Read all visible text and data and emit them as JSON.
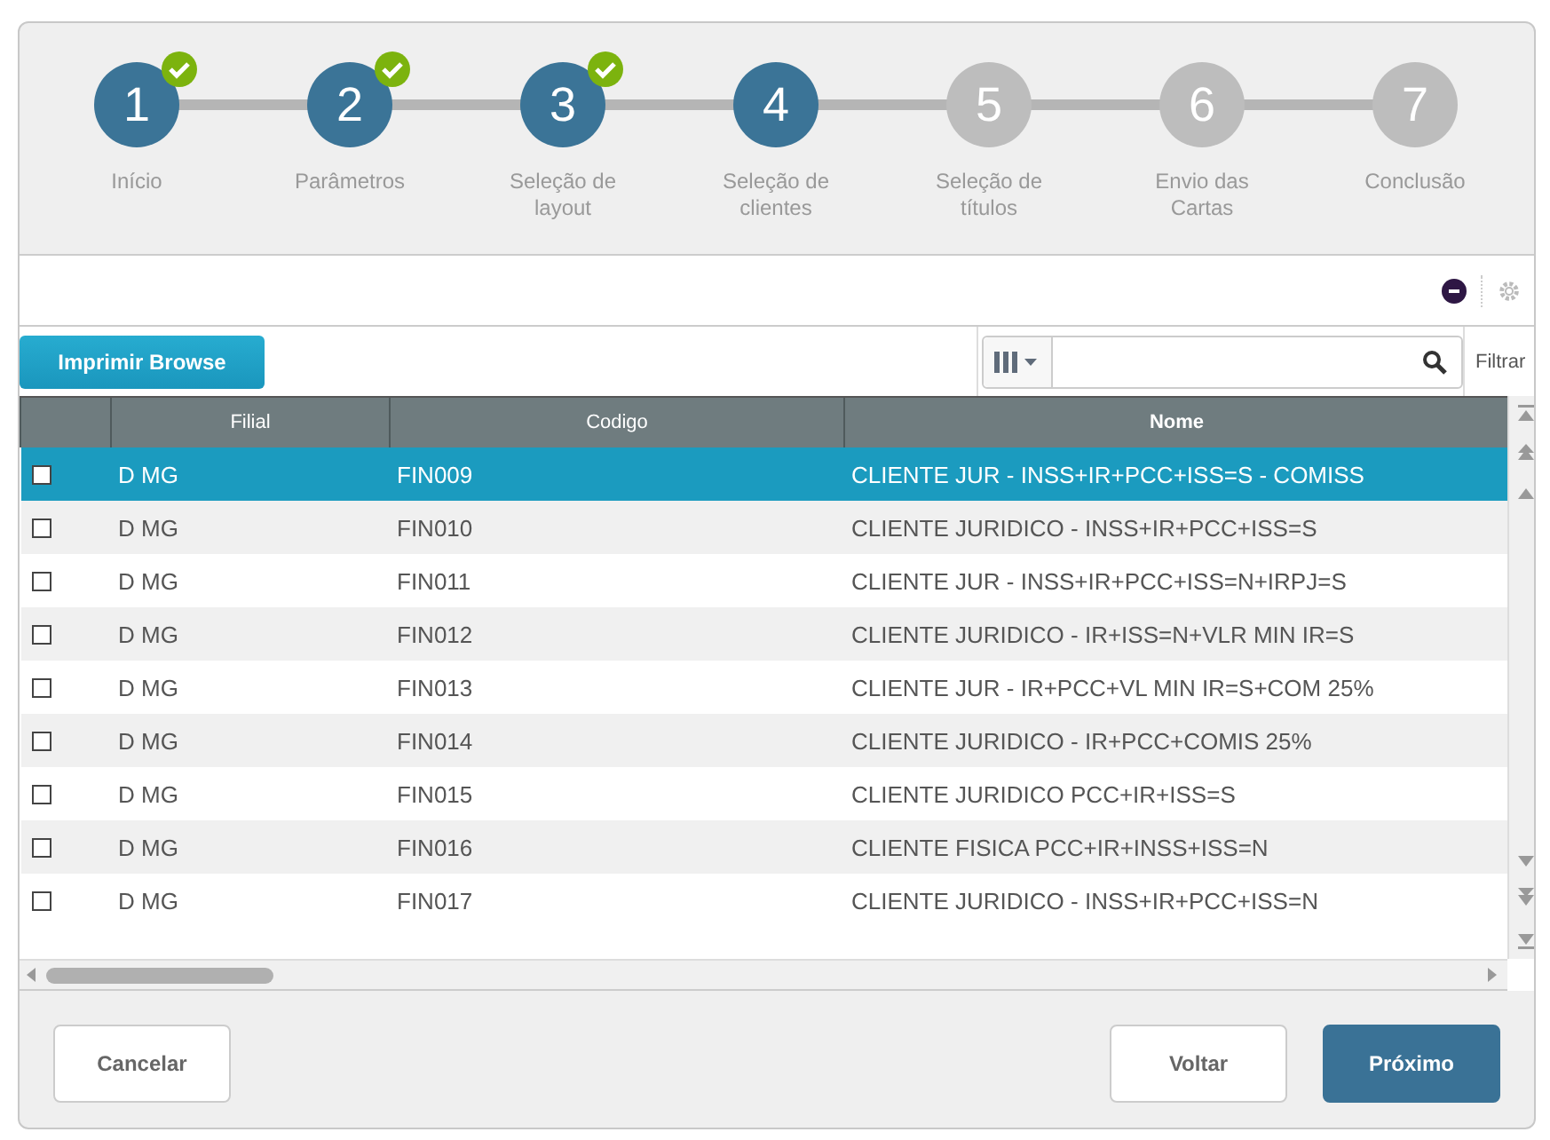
{
  "steps": [
    {
      "number": "1",
      "label": "Início",
      "completed": true,
      "active": false
    },
    {
      "number": "2",
      "label": "Parâmetros",
      "completed": true,
      "active": false
    },
    {
      "number": "3",
      "label": "Seleção de layout",
      "completed": true,
      "active": false
    },
    {
      "number": "4",
      "label": "Seleção de clientes",
      "completed": false,
      "active": true
    },
    {
      "number": "5",
      "label": "Seleção de títulos",
      "completed": false,
      "active": false
    },
    {
      "number": "6",
      "label": "Envio das Cartas",
      "completed": false,
      "active": false
    },
    {
      "number": "7",
      "label": "Conclusão",
      "completed": false,
      "active": false
    }
  ],
  "toolbar": {
    "print_button": "Imprimir Browse",
    "filter_button": "Filtrar"
  },
  "table": {
    "columns": [
      "",
      "Filial",
      "Codigo",
      "Nome"
    ],
    "rows": [
      {
        "checked": false,
        "selected": true,
        "filial": "D MG",
        "codigo": "FIN009",
        "nome": "CLIENTE JUR - INSS+IR+PCC+ISS=S - COMISS"
      },
      {
        "checked": false,
        "selected": false,
        "filial": "D MG",
        "codigo": "FIN010",
        "nome": "CLIENTE JURIDICO - INSS+IR+PCC+ISS=S"
      },
      {
        "checked": false,
        "selected": false,
        "filial": "D MG",
        "codigo": "FIN011",
        "nome": "CLIENTE JUR - INSS+IR+PCC+ISS=N+IRPJ=S"
      },
      {
        "checked": false,
        "selected": false,
        "filial": "D MG",
        "codigo": "FIN012",
        "nome": "CLIENTE JURIDICO - IR+ISS=N+VLR MIN IR=S"
      },
      {
        "checked": false,
        "selected": false,
        "filial": "D MG",
        "codigo": "FIN013",
        "nome": "CLIENTE JUR - IR+PCC+VL MIN IR=S+COM 25%"
      },
      {
        "checked": false,
        "selected": false,
        "filial": "D MG",
        "codigo": "FIN014",
        "nome": "CLIENTE JURIDICO - IR+PCC+COMIS 25%"
      },
      {
        "checked": false,
        "selected": false,
        "filial": "D MG",
        "codigo": "FIN015",
        "nome": "CLIENTE JURIDICO PCC+IR+ISS=S"
      },
      {
        "checked": false,
        "selected": false,
        "filial": "D MG",
        "codigo": "FIN016",
        "nome": "CLIENTE FISICA PCC+IR+INSS+ISS=N"
      },
      {
        "checked": false,
        "selected": false,
        "filial": "D MG",
        "codigo": "FIN017",
        "nome": "CLIENTE JURIDICO - INSS+IR+PCC+ISS=N"
      }
    ]
  },
  "footer": {
    "cancel": "Cancelar",
    "back": "Voltar",
    "next": "Próximo"
  }
}
